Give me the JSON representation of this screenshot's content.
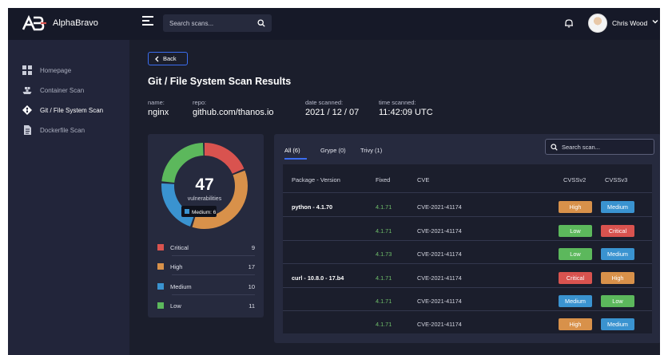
{
  "app": {
    "name": "AlphaBravo"
  },
  "topbar": {
    "search_placeholder": "Search scans...",
    "user_name": "Chris Wood"
  },
  "sidebar": {
    "items": [
      {
        "label": "Homepage",
        "icon": "grid-icon",
        "active": false
      },
      {
        "label": "Container Scan",
        "icon": "container-ship-icon",
        "active": false
      },
      {
        "label": "Git / File System Scan",
        "icon": "git-icon",
        "active": true
      },
      {
        "label": "Dockerfile Scan",
        "icon": "document-icon",
        "active": false
      }
    ]
  },
  "page": {
    "back_label": "Back",
    "title": "Git / File System Scan Results",
    "meta": {
      "name_label": "name:",
      "name_value": "nginx",
      "repo_label": "repo:",
      "repo_value": "github.com/thanos.io",
      "date_label": "date scanned:",
      "date_value": "2021 / 12 / 07",
      "time_label": "time scanned:",
      "time_value": "11:42:09 UTC"
    }
  },
  "summary": {
    "total": "47",
    "total_label": "vulnerabilities",
    "tooltip": "Medium: 6",
    "legend": [
      {
        "label": "Critical",
        "count": "9",
        "color": "#d9534f"
      },
      {
        "label": "High",
        "count": "17",
        "color": "#d8914a"
      },
      {
        "label": "Medium",
        "count": "10",
        "color": "#3a93d0"
      },
      {
        "label": "Low",
        "count": "11",
        "color": "#5cb85c"
      }
    ]
  },
  "results": {
    "tabs": [
      {
        "label": "All (6)",
        "active": true
      },
      {
        "label": "Grype (0)",
        "active": false
      },
      {
        "label": "Trivy (1)",
        "active": false
      }
    ],
    "search_placeholder": "Search scan...",
    "columns": [
      "Package - Version",
      "Fixed",
      "CVE",
      "CVSSv2",
      "CVSSv3"
    ],
    "rows": [
      {
        "package": "python - 4.1.70",
        "fixed": "4.1.71",
        "cve": "CVE-2021-41174",
        "cvss2": "High",
        "cvss3": "Medium"
      },
      {
        "package": "",
        "fixed": "4.1.71",
        "cve": "CVE-2021-41174",
        "cvss2": "Low",
        "cvss3": "Critical"
      },
      {
        "package": "",
        "fixed": "4.1.73",
        "cve": "CVE-2021-41174",
        "cvss2": "Low",
        "cvss3": "Medium"
      },
      {
        "package": "curl - 10.8.0 - 17.b4",
        "fixed": "4.1.71",
        "cve": "CVE-2021-41174",
        "cvss2": "Critical",
        "cvss3": "High"
      },
      {
        "package": "",
        "fixed": "4.1.71",
        "cve": "CVE-2021-41174",
        "cvss2": "Medium",
        "cvss3": "Low"
      },
      {
        "package": "",
        "fixed": "4.1.71",
        "cve": "CVE-2021-41174",
        "cvss2": "High",
        "cvss3": "Medium"
      }
    ]
  },
  "colors": {
    "accent": "#3b6df0",
    "critical": "#d9534f",
    "high": "#d8914a",
    "medium": "#3a93d0",
    "low": "#5cb85c"
  }
}
